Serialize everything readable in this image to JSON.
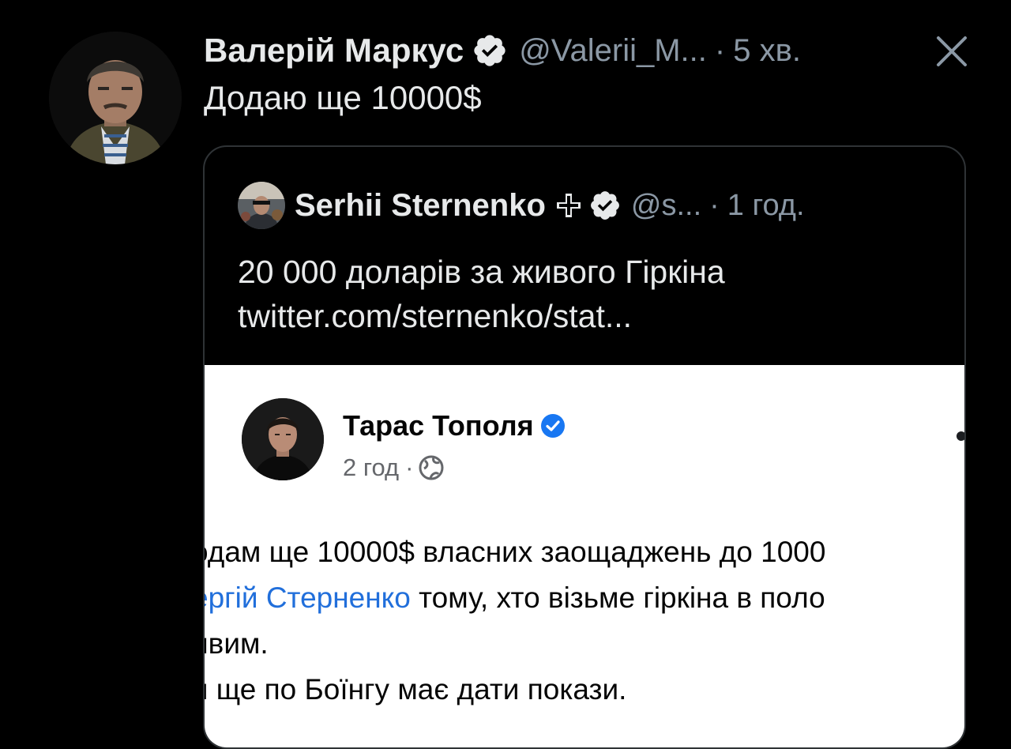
{
  "tweet": {
    "author_name": "Валерій Маркус",
    "handle": "@Valerii_M...",
    "separator": "·",
    "time": "5 хв.",
    "text": "Додаю ще 10000$"
  },
  "quote": {
    "author_name": "Serhii Sternenko",
    "handle": "@s...",
    "separator": "·",
    "time": "1 год.",
    "text_line1": "20 000 доларів за живого Гіркіна",
    "text_line2": "twitter.com/sternenko/stat..."
  },
  "embedded_post": {
    "author_name": "Тарас Тополя",
    "time": "2 год",
    "separator": "·",
    "line1": "одам ще 10000$ власних заощаджень до 1000",
    "line2_link": "ергій Стерненко",
    "line2_rest": " тому, хто візьме гіркіна в поло",
    "line3": "ивим.",
    "line4": "н ще по Боїнгу має дати покази."
  },
  "icons": {
    "verified": "verified-badge-icon",
    "close": "close-icon",
    "cross": "cross-icon",
    "globe": "globe-icon",
    "more": "more-icon"
  },
  "colors": {
    "background": "#000000",
    "text": "#e7e9ea",
    "muted": "#8b98a5",
    "card_border": "#2f3336",
    "fb_link": "#216fdb",
    "fb_verified": "#1877f2"
  }
}
